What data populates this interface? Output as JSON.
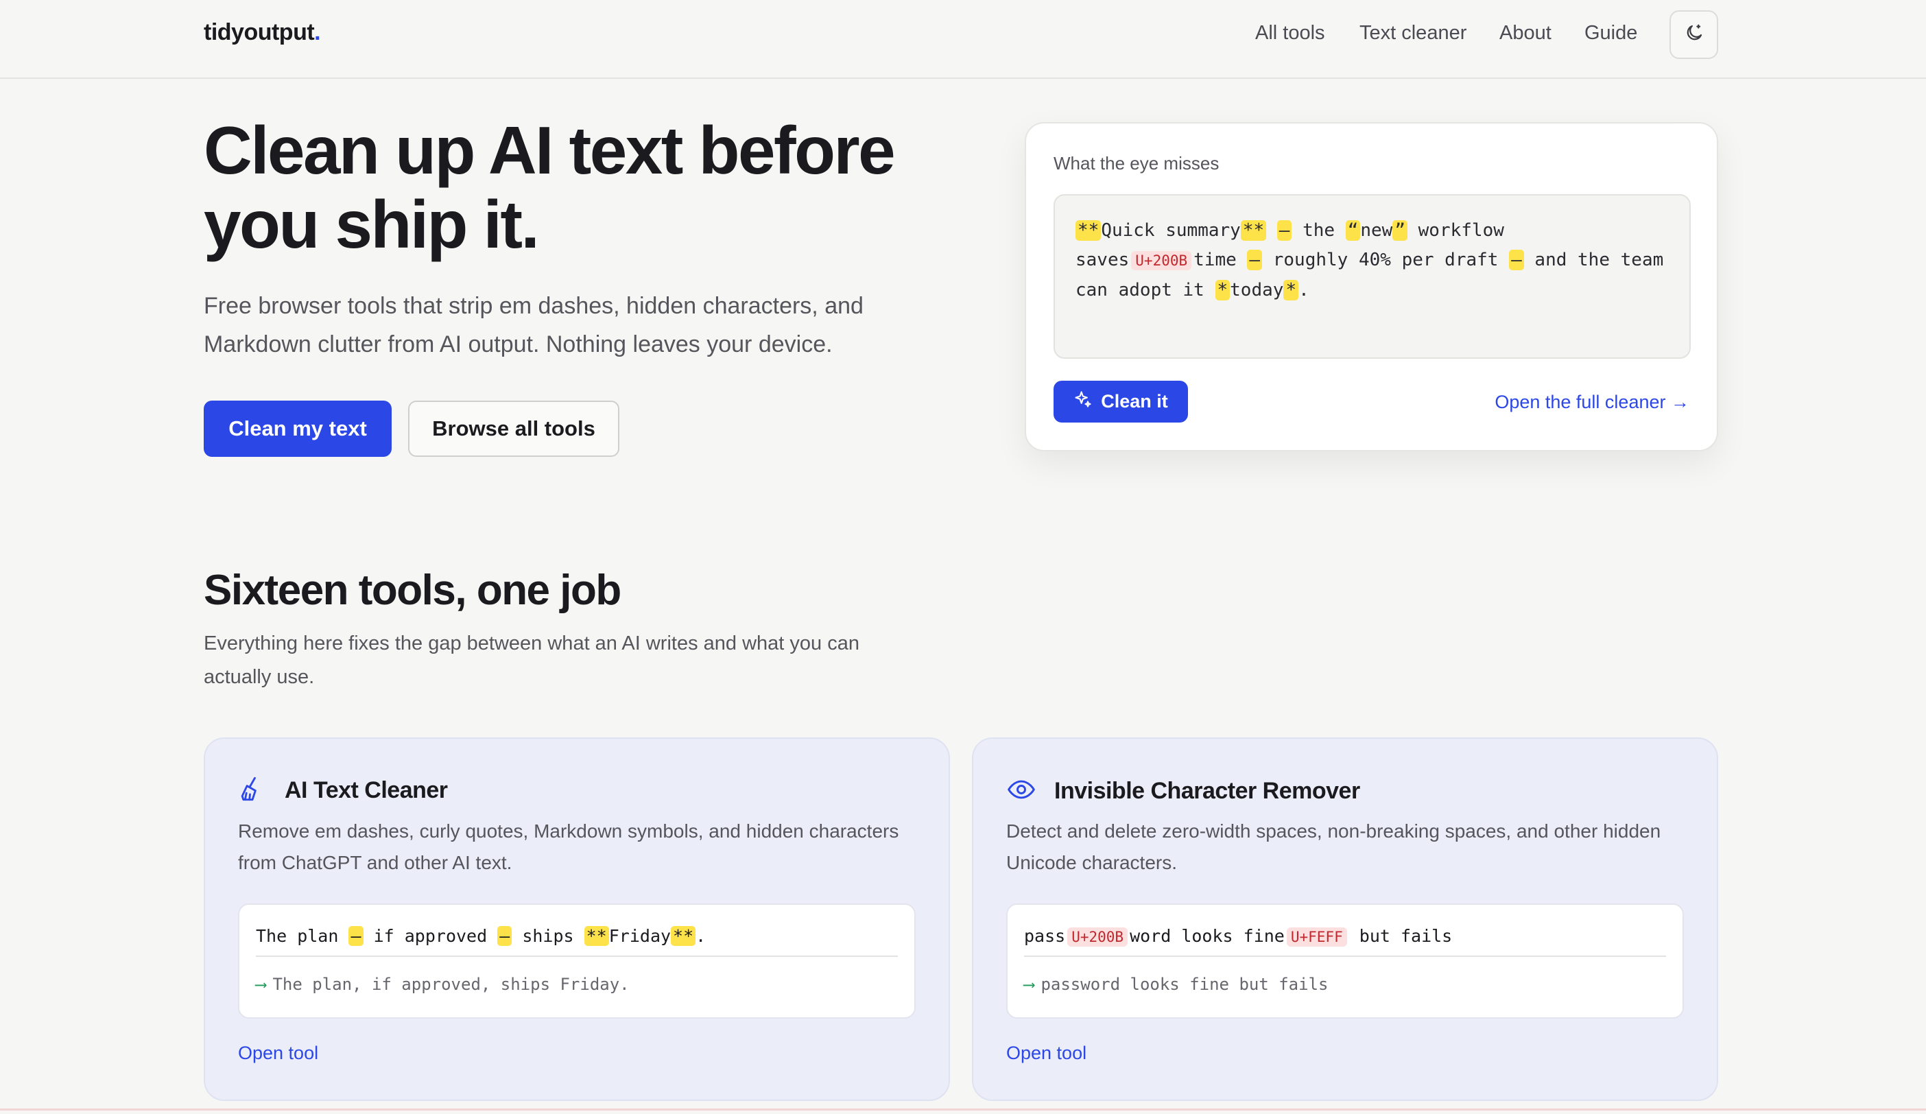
{
  "header": {
    "logo_text": "tidyoutput",
    "logo_dot": ".",
    "nav": [
      "All tools",
      "Text cleaner",
      "About",
      "Guide"
    ],
    "theme_icon": "moon-icon"
  },
  "hero": {
    "title": "Clean up AI text before you ship it.",
    "subtitle": "Free browser tools that strip em dashes, hidden characters, and Markdown clutter from AI output. Nothing leaves your device.",
    "primary_button": "Clean my text",
    "secondary_button": "Browse all tools"
  },
  "demo": {
    "label": "What the eye misses",
    "sample_text": "**Quick summary** — the “new” workflow saves U+200B time — roughly 40% per draft — and the team can adopt it *today*.",
    "clean_button": "Clean it",
    "clean_icon": "sparkle-icon",
    "open_full_link": "Open the full cleaner →"
  },
  "tools_section": {
    "title": "Sixteen tools, one job",
    "subtitle": "Everything here fixes the gap between what an AI writes and what you can actually use.",
    "tools": [
      {
        "icon": "broom-icon",
        "title": "AI Text Cleaner",
        "description": "Remove em dashes, curly quotes, Markdown symbols, and hidden characters from ChatGPT and other AI text.",
        "example_input": "The plan — if approved — ships **Friday**.",
        "example_output": "The plan, if approved, ships Friday.",
        "link": "Open tool"
      },
      {
        "icon": "eye-icon",
        "title": "Invisible Character Remover",
        "description": "Detect and delete zero-width spaces, non-breaking spaces, and other hidden Unicode characters.",
        "example_input": "pass U+200B word looks fine U+FEFF but fails",
        "example_output": "password looks fine but fails",
        "link": "Open tool"
      }
    ]
  },
  "colors": {
    "accent": "#2b47e6",
    "highlight": "#fde24a",
    "hidden_char_tag": "#fce0e0",
    "card_background": "#ebedf9"
  }
}
